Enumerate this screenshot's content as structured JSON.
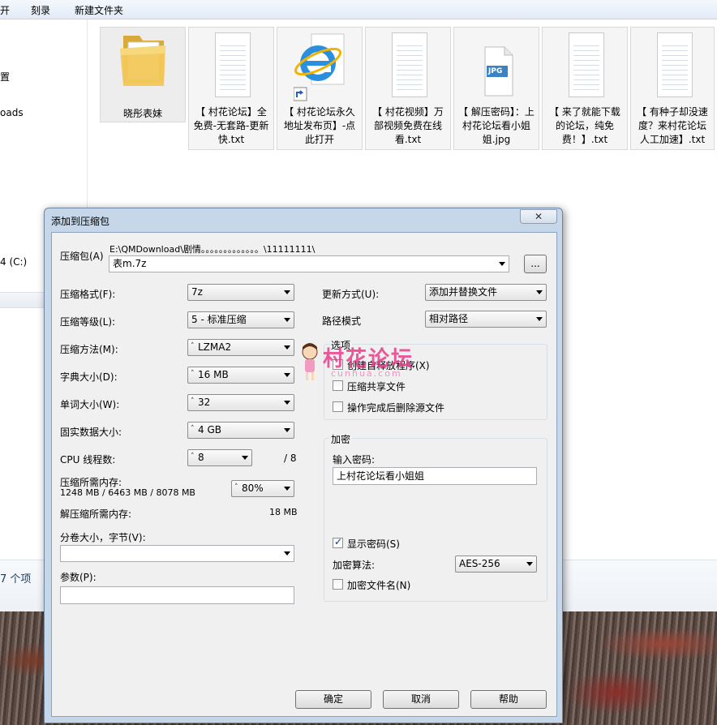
{
  "explorer": {
    "menu": [
      "开",
      "刻录",
      "新建文件夹"
    ],
    "nav_items": [
      "置",
      "oads",
      "4 (C:)"
    ],
    "status": "7 个项",
    "files": [
      {
        "name": "晓彤表妹",
        "kind": "folder"
      },
      {
        "name": "【 村花论坛】全免费-无套路-更新快.txt",
        "kind": "txt"
      },
      {
        "name": "【 村花论坛永久地址发布页】-点此打开",
        "kind": "shortcut"
      },
      {
        "name": "【 村花视频】万部视频免费在线看.txt",
        "kind": "txt"
      },
      {
        "name": "【 解压密码】：上村花论坛看小姐姐.jpg",
        "kind": "jpg"
      },
      {
        "name": "【 来了就能下载的论坛，纯免费！】.txt",
        "kind": "txt"
      },
      {
        "name": "【 有种子却没速度？来村花论坛人工加速】.txt",
        "kind": "txt"
      }
    ],
    "jpg_badge": "JPG"
  },
  "dialog": {
    "title": "添加到压缩包",
    "close_label": "✕",
    "archive": {
      "label": "压缩包(A)",
      "path": "E:\\QMDownload\\剧情。。。。。。。。。。。。。\\11111111\\",
      "name": "表m.7z",
      "browse_label": "..."
    },
    "left": {
      "format_label": "压缩格式(F):",
      "format_value": "7z",
      "level_label": "压缩等级(L):",
      "level_value": "5 - 标准压缩",
      "method_label": "压缩方法(M):",
      "method_value": "LZMA2",
      "dict_label": "字典大小(D):",
      "dict_value": "16 MB",
      "word_label": "单词大小(W):",
      "word_value": "32",
      "solid_label": "固实数据大小:",
      "solid_value": "4 GB",
      "cpu_label": "CPU 线程数:",
      "cpu_value": "8",
      "cpu_total": "/ 8",
      "mem_label": "压缩所需内存:",
      "mem_value": "1248 MB / 6463 MB / 8078 MB",
      "mem_pct": "80%",
      "decomp_label": "解压缩所需内存:",
      "decomp_value": "18 MB",
      "split_label": "分卷大小，字节(V):",
      "split_value": "",
      "params_label": "参数(P):",
      "params_value": ""
    },
    "right": {
      "update_label": "更新方式(U):",
      "update_value": "添加并替换文件",
      "path_label": "路径模式",
      "path_value": "相对路径",
      "options_title": "选项",
      "opt_sfx": "创建自释放程序(X)",
      "opt_shared": "压缩共享文件",
      "opt_delete": "操作完成后删除源文件",
      "enc_title": "加密",
      "password_label": "输入密码:",
      "password_value": "上村花论坛看小姐姐",
      "show_password": "显示密码(S)",
      "algo_label": "加密算法:",
      "algo_value": "AES-256",
      "encrypt_names": "加密文件名(N)"
    },
    "buttons": {
      "ok": "确定",
      "cancel": "取消",
      "help": "帮助"
    },
    "watermark": {
      "text": "村花论坛",
      "sub": "cunhua.com"
    }
  }
}
